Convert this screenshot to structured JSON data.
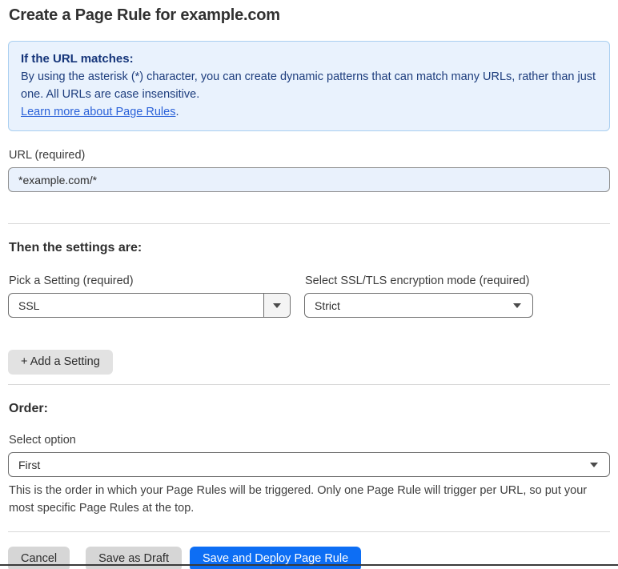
{
  "page": {
    "title": "Create a Page Rule for example.com"
  },
  "info_box": {
    "heading": "If the URL matches:",
    "body": "By using the asterisk (*) character, you can create dynamic patterns that can match many URLs, rather than just one. All URLs are case insensitive.",
    "link_label": "Learn more about Page Rules",
    "link_suffix": "."
  },
  "url_field": {
    "label": "URL (required)",
    "value": "*example.com/*"
  },
  "settings": {
    "heading": "Then the settings are:",
    "pick_setting": {
      "label": "Pick a Setting (required)",
      "value": "SSL"
    },
    "ssl_mode": {
      "label": "Select SSL/TLS encryption mode (required)",
      "value": "Strict"
    },
    "add_button_label": "+ Add a Setting"
  },
  "order": {
    "heading": "Order:",
    "select_label": "Select option",
    "value": "First",
    "help_text": "This is the order in which your Page Rules will be triggered. Only one Page Rule will trigger per URL, so put your most specific Page Rules at the top."
  },
  "footer": {
    "cancel_label": "Cancel",
    "save_draft_label": "Save as Draft",
    "save_deploy_label": "Save and Deploy Page Rule"
  },
  "colors": {
    "primary_button": "#0d6ef4",
    "info_background": "#e9f2fd",
    "info_border": "#a9cff0",
    "info_text": "#1d3d7d",
    "link": "#2b62d9",
    "url_input_background": "#e9f1fc"
  }
}
